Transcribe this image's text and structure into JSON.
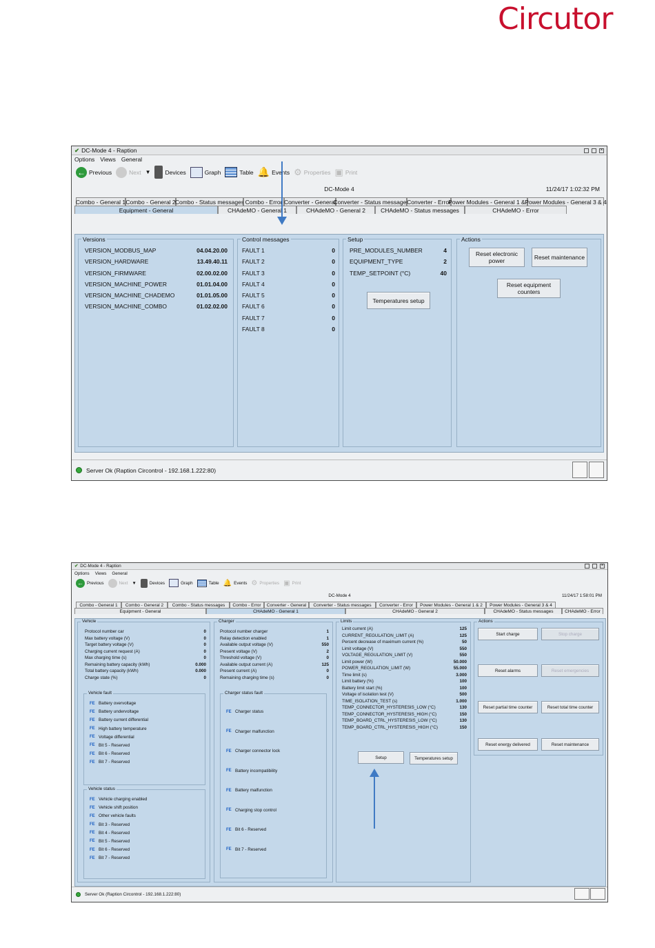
{
  "brand": {
    "logo": "Circutor",
    "color": "#c8102e"
  },
  "colors": {
    "panel_bg": "#c4d8ea",
    "arrow": "#3f7ac4",
    "status_ok": "#35a83b"
  },
  "w1": {
    "title": "DC-Mode 4 - Raption",
    "menu": [
      "Options",
      "Views",
      "General"
    ],
    "toolbar": [
      "Previous",
      "Next",
      "Devices",
      "Graph",
      "Table",
      "Events",
      "Properties",
      "Print"
    ],
    "heading": "DC-Mode 4",
    "datetime": "11/24/17 1:02:32 PM",
    "tabs_top": [
      "Combo - General 1",
      "Combo - General 2",
      "Combo - Status messages",
      "Combo - Error",
      "Converter - General",
      "Converter - Status messages",
      "Converter - Error",
      "Power Modules - General 1 & 2",
      "Power Modules - General 3 & 4"
    ],
    "tabs_bottom": [
      "Equipment - General",
      "CHAdeMO - General 1",
      "CHAdeMO - General 2",
      "CHAdeMO - Status messages",
      "CHAdeMO - Error"
    ],
    "versions": {
      "title": "Versions",
      "rows": [
        {
          "k": "VERSION_MODBUS_MAP",
          "v": "04.04.20.00"
        },
        {
          "k": "VERSION_HARDWARE",
          "v": "13.49.40.11"
        },
        {
          "k": "VERSION_FIRMWARE",
          "v": "02.00.02.00"
        },
        {
          "k": "VERSION_MACHINE_POWER",
          "v": "01.01.04.00"
        },
        {
          "k": "VERSION_MACHINE_CHADEMO",
          "v": "01.01.05.00"
        },
        {
          "k": "VERSION_MACHINE_COMBO",
          "v": "01.02.02.00"
        }
      ]
    },
    "control": {
      "title": "Control messages",
      "rows": [
        {
          "k": "FAULT 1",
          "v": "0"
        },
        {
          "k": "FAULT 2",
          "v": "0"
        },
        {
          "k": "FAULT 3",
          "v": "0"
        },
        {
          "k": "FAULT 4",
          "v": "0"
        },
        {
          "k": "FAULT 5",
          "v": "0"
        },
        {
          "k": "FAULT 6",
          "v": "0"
        },
        {
          "k": "FAULT 7",
          "v": "0"
        },
        {
          "k": "FAULT 8",
          "v": "0"
        }
      ]
    },
    "setup": {
      "title": "Setup",
      "rows": [
        {
          "k": "PRE_MODULES_NUMBER",
          "v": "4"
        },
        {
          "k": "EQUIPMENT_TYPE",
          "v": "2"
        },
        {
          "k": "TEMP_SETPOINT (°C)",
          "v": "40"
        }
      ],
      "button": "Temperatures setup"
    },
    "actions": {
      "title": "Actions",
      "reset_power": "Reset electronic power",
      "reset_maint": "Reset maintenance",
      "reset_counters": "Reset equipment counters"
    },
    "status": "Server Ok (Raption Circontrol - 192.168.1.222:80)"
  },
  "w2": {
    "title": "DC-Mode 4 - Raption",
    "menu": [
      "Options",
      "Views",
      "General"
    ],
    "toolbar": [
      "Previous",
      "Next",
      "Devices",
      "Graph",
      "Table",
      "Events",
      "Properties",
      "Print"
    ],
    "heading": "DC-Mode 4",
    "datetime": "11/24/17 1:58:01 PM",
    "tabs_top": [
      "Combo - General 1",
      "Combo - General 2",
      "Combo - Status messages",
      "Combo - Error",
      "Converter - General",
      "Converter - Status messages",
      "Converter - Error",
      "Power Modules - General 1 & 2",
      "Power Modules - General 3 & 4"
    ],
    "tabs_bottom": [
      "Equipment - General",
      "CHAdeMO - General 1",
      "CHAdeMO - General 2",
      "CHAdeMO - Status messages",
      "CHAdeMO - Error"
    ],
    "vehicle": {
      "title": "Vehicle",
      "rows": [
        {
          "k": "Protocol number car",
          "v": "0"
        },
        {
          "k": "Max battery voltage (V)",
          "v": "0"
        },
        {
          "k": "Target battery voltage (V)",
          "v": "0"
        },
        {
          "k": "Charging current request (A)",
          "v": "0"
        },
        {
          "k": "Max charging time (s)",
          "v": "0"
        },
        {
          "k": "Remaining battery capacity (kWh)",
          "v": "0.000"
        },
        {
          "k": "Total battery capacity (kWh)",
          "v": "0.000"
        },
        {
          "k": "Charge state (%)",
          "v": "0"
        }
      ],
      "fault_title": "Vehicle fault",
      "faults": [
        "Battery overvoltage",
        "Battery undervoltage",
        "Battery current differential",
        "High battery temperature",
        "Voltage differential",
        "Bit 5 - Reserved",
        "Bit 6 - Reserved",
        "Bit 7 - Reserved"
      ],
      "status_title": "Vehicle status",
      "statuses": [
        "Vehicle charging enabled",
        "Vehicle shift position",
        "Other vehicle faults",
        "Bit 3 - Reserved",
        "Bit 4 - Reserved",
        "Bit 5 - Reserved",
        "Bit 6 - Reserved",
        "Bit 7 - Reserved"
      ]
    },
    "charger": {
      "title": "Charger",
      "rows": [
        {
          "k": "Protocol number charger",
          "v": "1"
        },
        {
          "k": "Relay detection enabled",
          "v": "1"
        },
        {
          "k": "Available output voltage (V)",
          "v": "550"
        },
        {
          "k": "Present voltage (V)",
          "v": "2"
        },
        {
          "k": "Threshold voltage (V)",
          "v": "0"
        },
        {
          "k": "Available output current (A)",
          "v": "125"
        },
        {
          "k": "Present current (A)",
          "v": "0"
        },
        {
          "k": "Remaining charging time (s)",
          "v": "0"
        }
      ],
      "fault_title": "Charger status fault",
      "faults": [
        "Charger status",
        "Charger malfunction",
        "Charger connector lock",
        "Battery incompatibility",
        "Battery malfunction",
        "Charging stop control",
        "Bit 6 - Reserved",
        "Bit 7 - Reserved"
      ]
    },
    "limits": {
      "title": "Limits",
      "rows": [
        {
          "k": "Limit current (A)",
          "v": "125"
        },
        {
          "k": "CURRENT_REGULATION_LIMIT (A)",
          "v": "125"
        },
        {
          "k": "Percent decrease of maximum current (%)",
          "v": "50"
        },
        {
          "k": "Limit voltage (V)",
          "v": "550"
        },
        {
          "k": "VOLTAGE_REGULATION_LIMIT (V)",
          "v": "550"
        },
        {
          "k": "Limit power (W)",
          "v": "50.000"
        },
        {
          "k": "POWER_REGULATION_LIMIT (W)",
          "v": "55.000"
        },
        {
          "k": "Time limit (s)",
          "v": "3.000"
        },
        {
          "k": "Limit battery (%)",
          "v": "100"
        },
        {
          "k": "Battery limit start (%)",
          "v": "100"
        },
        {
          "k": "Voltage of isolation test (V)",
          "v": "500"
        },
        {
          "k": "TIME_ISOLATION_TEST (s)",
          "v": "1.000"
        },
        {
          "k": "TEMP_CONNECTOR_HYSTERESIS_LOW (°C)",
          "v": "130"
        },
        {
          "k": "TEMP_CONNECTOR_HYSTERESIS_HIGH (°C)",
          "v": "150"
        },
        {
          "k": "TEMP_BOARD_CTRL_HYSTERESIS_LOW (°C)",
          "v": "130"
        },
        {
          "k": "TEMP_BOARD_CTRL_HYSTERESIS_HIGH (°C)",
          "v": "150"
        }
      ],
      "setup_btn": "Setup",
      "temp_btn": "Temperatures setup"
    },
    "actions": {
      "title": "Actions",
      "start": "Start charge",
      "stop": "Stop charge",
      "reset_alarms": "Reset alarms",
      "reset_emergencies": "Reset emergencies",
      "reset_partial": "Reset partial time counter",
      "reset_total": "Reset total time counter",
      "reset_energy": "Reset energy delivered",
      "reset_maint": "Reset maintenance"
    },
    "status": "Server Ok (Raption Circontrol - 192.168.1.222:80)"
  }
}
